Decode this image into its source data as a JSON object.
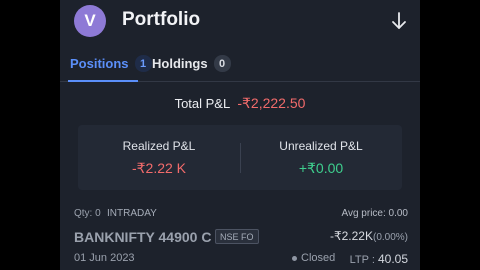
{
  "header": {
    "avatar_initial": "V",
    "title": "Portfolio",
    "download_icon": "download-arrow-icon"
  },
  "tabs": [
    {
      "label": "Positions",
      "count": "1",
      "active": true
    },
    {
      "label": "Holdings",
      "count": "0",
      "active": false
    }
  ],
  "summary": {
    "total_label": "Total P&L",
    "total_value": "-₹2,222.50",
    "realized_label": "Realized P&L",
    "realized_value": "-₹2.22 K",
    "unrealized_label": "Unrealized P&L",
    "unrealized_value": "+₹0.00"
  },
  "position": {
    "qty": "Qty: 0",
    "product": "INTRADAY",
    "avg_price": "Avg price: 0.00",
    "symbol": "BANKNIFTY 44900 C",
    "exchange": "NSE FO",
    "pnl": "-₹2.22K",
    "pnl_pct": "(0.00%)",
    "date": "01 Jun 2023",
    "status": "Closed",
    "ltp_label": "LTP :",
    "ltp_value": "40.05"
  },
  "colors": {
    "accent": "#5b8ff9",
    "loss": "#f26b6b",
    "profit": "#3ecf8e",
    "background": "#1d222c"
  }
}
